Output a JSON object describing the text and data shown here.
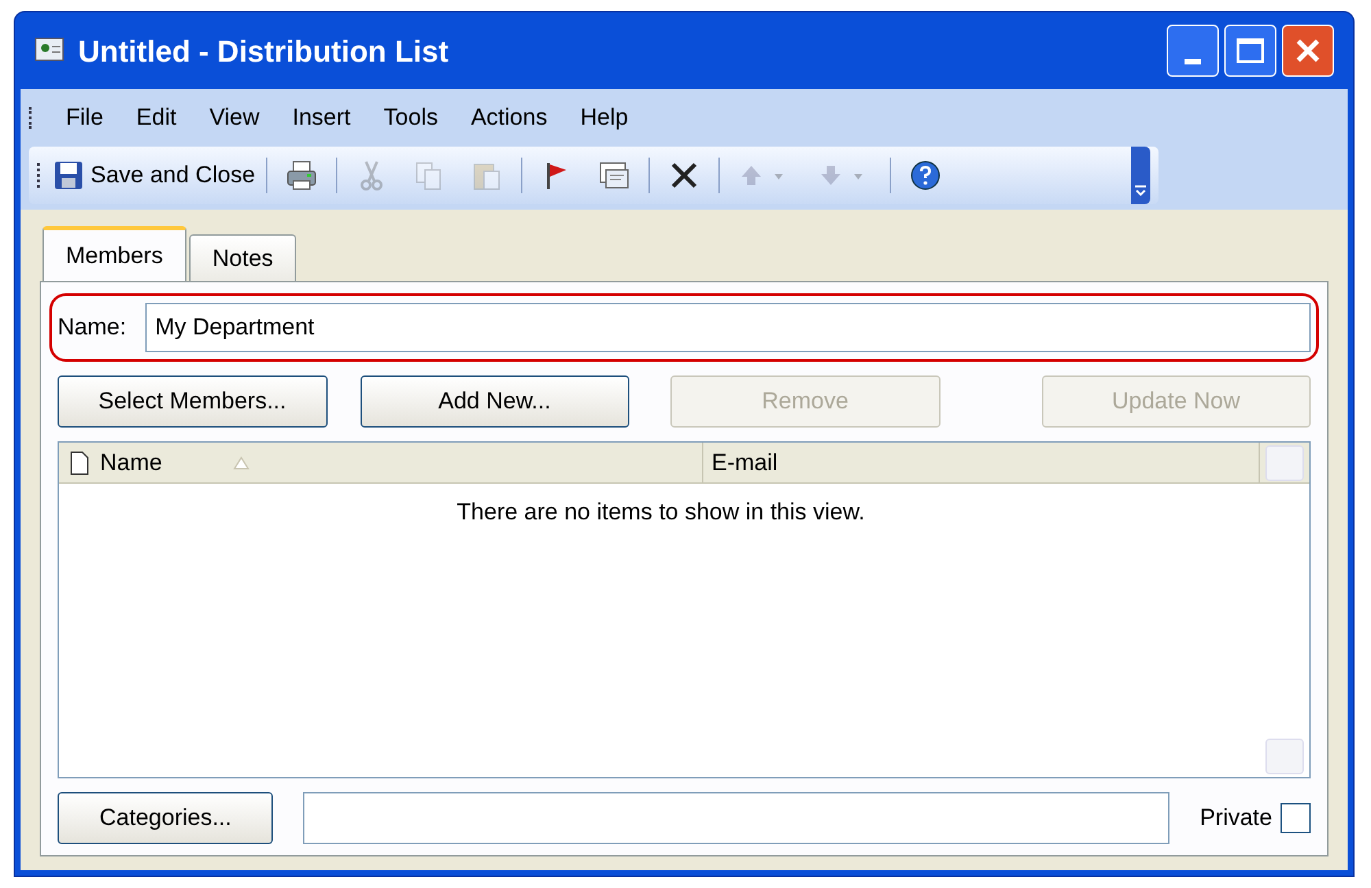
{
  "window": {
    "title": "Untitled - Distribution List"
  },
  "menu": [
    "File",
    "Edit",
    "View",
    "Insert",
    "Tools",
    "Actions",
    "Help"
  ],
  "toolbar": [
    {
      "kind": "save",
      "label": "Save and Close",
      "disabled": false
    },
    {
      "kind": "sep"
    },
    {
      "kind": "print",
      "disabled": false
    },
    {
      "kind": "sep"
    },
    {
      "kind": "cut",
      "disabled": true
    },
    {
      "kind": "copy",
      "disabled": true
    },
    {
      "kind": "paste",
      "disabled": true
    },
    {
      "kind": "sep"
    },
    {
      "kind": "flag",
      "disabled": false
    },
    {
      "kind": "card",
      "disabled": false
    },
    {
      "kind": "sep"
    },
    {
      "kind": "delete",
      "disabled": false
    },
    {
      "kind": "sep"
    },
    {
      "kind": "up",
      "disabled": true
    },
    {
      "kind": "down",
      "disabled": true
    },
    {
      "kind": "sep"
    },
    {
      "kind": "help",
      "disabled": false
    }
  ],
  "tabs": [
    {
      "label": "Members",
      "selected": true
    },
    {
      "label": "Notes",
      "selected": false
    }
  ],
  "name_field": {
    "label": "Name:",
    "value": "My Department",
    "highlighted": true
  },
  "buttons": [
    {
      "label": "Select Members...",
      "disabled": false
    },
    {
      "label": "Add New...",
      "disabled": false
    },
    {
      "label": "Remove",
      "disabled": true
    },
    {
      "label": "Update Now",
      "disabled": true
    }
  ],
  "table": {
    "columns": [
      "Name",
      "E-mail"
    ],
    "empty_message": "There are no items to show in this view."
  },
  "categories": {
    "label": "Categories..."
  },
  "private": {
    "label": "Private",
    "checked": false
  }
}
